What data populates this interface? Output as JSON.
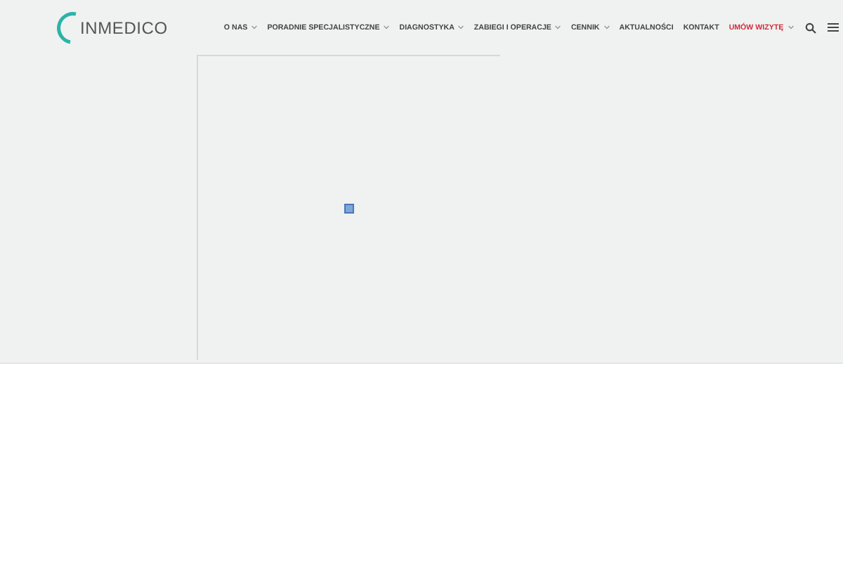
{
  "logo": {
    "text": "INMEDICO"
  },
  "nav": [
    {
      "label": "O NAS",
      "has_dropdown": true,
      "highlighted": false
    },
    {
      "label": "PORADNIE SPECJALISTYCZNE",
      "has_dropdown": true,
      "highlighted": false
    },
    {
      "label": "DIAGNOSTYKA",
      "has_dropdown": true,
      "highlighted": false
    },
    {
      "label": "ZABIEGI I OPERACJE",
      "has_dropdown": true,
      "highlighted": false
    },
    {
      "label": "CENNIK",
      "has_dropdown": true,
      "highlighted": false
    },
    {
      "label": "AKTUALNOŚCI",
      "has_dropdown": false,
      "highlighted": false
    },
    {
      "label": "KONTAKT",
      "has_dropdown": false,
      "highlighted": false
    },
    {
      "label": "UMÓW WIZYTĘ",
      "has_dropdown": true,
      "highlighted": true
    }
  ]
}
